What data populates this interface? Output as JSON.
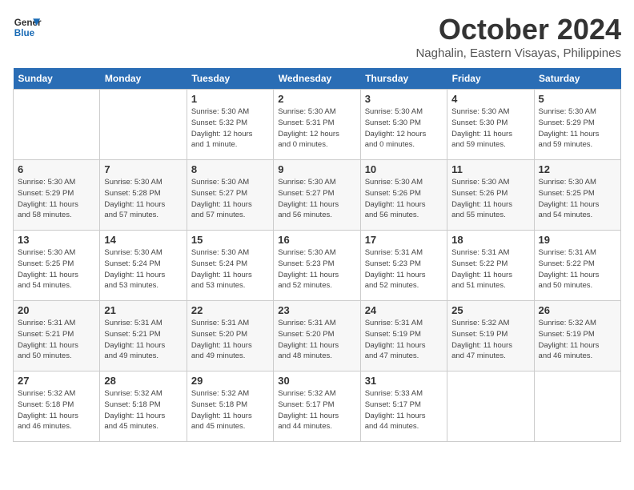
{
  "logo": {
    "line1": "General",
    "line2": "Blue"
  },
  "title": "October 2024",
  "location": "Naghalin, Eastern Visayas, Philippines",
  "days_of_week": [
    "Sunday",
    "Monday",
    "Tuesday",
    "Wednesday",
    "Thursday",
    "Friday",
    "Saturday"
  ],
  "weeks": [
    [
      {
        "day": "",
        "info": ""
      },
      {
        "day": "",
        "info": ""
      },
      {
        "day": "1",
        "info": "Sunrise: 5:30 AM\nSunset: 5:32 PM\nDaylight: 12 hours\nand 1 minute."
      },
      {
        "day": "2",
        "info": "Sunrise: 5:30 AM\nSunset: 5:31 PM\nDaylight: 12 hours\nand 0 minutes."
      },
      {
        "day": "3",
        "info": "Sunrise: 5:30 AM\nSunset: 5:30 PM\nDaylight: 12 hours\nand 0 minutes."
      },
      {
        "day": "4",
        "info": "Sunrise: 5:30 AM\nSunset: 5:30 PM\nDaylight: 11 hours\nand 59 minutes."
      },
      {
        "day": "5",
        "info": "Sunrise: 5:30 AM\nSunset: 5:29 PM\nDaylight: 11 hours\nand 59 minutes."
      }
    ],
    [
      {
        "day": "6",
        "info": "Sunrise: 5:30 AM\nSunset: 5:29 PM\nDaylight: 11 hours\nand 58 minutes."
      },
      {
        "day": "7",
        "info": "Sunrise: 5:30 AM\nSunset: 5:28 PM\nDaylight: 11 hours\nand 57 minutes."
      },
      {
        "day": "8",
        "info": "Sunrise: 5:30 AM\nSunset: 5:27 PM\nDaylight: 11 hours\nand 57 minutes."
      },
      {
        "day": "9",
        "info": "Sunrise: 5:30 AM\nSunset: 5:27 PM\nDaylight: 11 hours\nand 56 minutes."
      },
      {
        "day": "10",
        "info": "Sunrise: 5:30 AM\nSunset: 5:26 PM\nDaylight: 11 hours\nand 56 minutes."
      },
      {
        "day": "11",
        "info": "Sunrise: 5:30 AM\nSunset: 5:26 PM\nDaylight: 11 hours\nand 55 minutes."
      },
      {
        "day": "12",
        "info": "Sunrise: 5:30 AM\nSunset: 5:25 PM\nDaylight: 11 hours\nand 54 minutes."
      }
    ],
    [
      {
        "day": "13",
        "info": "Sunrise: 5:30 AM\nSunset: 5:25 PM\nDaylight: 11 hours\nand 54 minutes."
      },
      {
        "day": "14",
        "info": "Sunrise: 5:30 AM\nSunset: 5:24 PM\nDaylight: 11 hours\nand 53 minutes."
      },
      {
        "day": "15",
        "info": "Sunrise: 5:30 AM\nSunset: 5:24 PM\nDaylight: 11 hours\nand 53 minutes."
      },
      {
        "day": "16",
        "info": "Sunrise: 5:30 AM\nSunset: 5:23 PM\nDaylight: 11 hours\nand 52 minutes."
      },
      {
        "day": "17",
        "info": "Sunrise: 5:31 AM\nSunset: 5:23 PM\nDaylight: 11 hours\nand 52 minutes."
      },
      {
        "day": "18",
        "info": "Sunrise: 5:31 AM\nSunset: 5:22 PM\nDaylight: 11 hours\nand 51 minutes."
      },
      {
        "day": "19",
        "info": "Sunrise: 5:31 AM\nSunset: 5:22 PM\nDaylight: 11 hours\nand 50 minutes."
      }
    ],
    [
      {
        "day": "20",
        "info": "Sunrise: 5:31 AM\nSunset: 5:21 PM\nDaylight: 11 hours\nand 50 minutes."
      },
      {
        "day": "21",
        "info": "Sunrise: 5:31 AM\nSunset: 5:21 PM\nDaylight: 11 hours\nand 49 minutes."
      },
      {
        "day": "22",
        "info": "Sunrise: 5:31 AM\nSunset: 5:20 PM\nDaylight: 11 hours\nand 49 minutes."
      },
      {
        "day": "23",
        "info": "Sunrise: 5:31 AM\nSunset: 5:20 PM\nDaylight: 11 hours\nand 48 minutes."
      },
      {
        "day": "24",
        "info": "Sunrise: 5:31 AM\nSunset: 5:19 PM\nDaylight: 11 hours\nand 47 minutes."
      },
      {
        "day": "25",
        "info": "Sunrise: 5:32 AM\nSunset: 5:19 PM\nDaylight: 11 hours\nand 47 minutes."
      },
      {
        "day": "26",
        "info": "Sunrise: 5:32 AM\nSunset: 5:19 PM\nDaylight: 11 hours\nand 46 minutes."
      }
    ],
    [
      {
        "day": "27",
        "info": "Sunrise: 5:32 AM\nSunset: 5:18 PM\nDaylight: 11 hours\nand 46 minutes."
      },
      {
        "day": "28",
        "info": "Sunrise: 5:32 AM\nSunset: 5:18 PM\nDaylight: 11 hours\nand 45 minutes."
      },
      {
        "day": "29",
        "info": "Sunrise: 5:32 AM\nSunset: 5:18 PM\nDaylight: 11 hours\nand 45 minutes."
      },
      {
        "day": "30",
        "info": "Sunrise: 5:32 AM\nSunset: 5:17 PM\nDaylight: 11 hours\nand 44 minutes."
      },
      {
        "day": "31",
        "info": "Sunrise: 5:33 AM\nSunset: 5:17 PM\nDaylight: 11 hours\nand 44 minutes."
      },
      {
        "day": "",
        "info": ""
      },
      {
        "day": "",
        "info": ""
      }
    ]
  ]
}
